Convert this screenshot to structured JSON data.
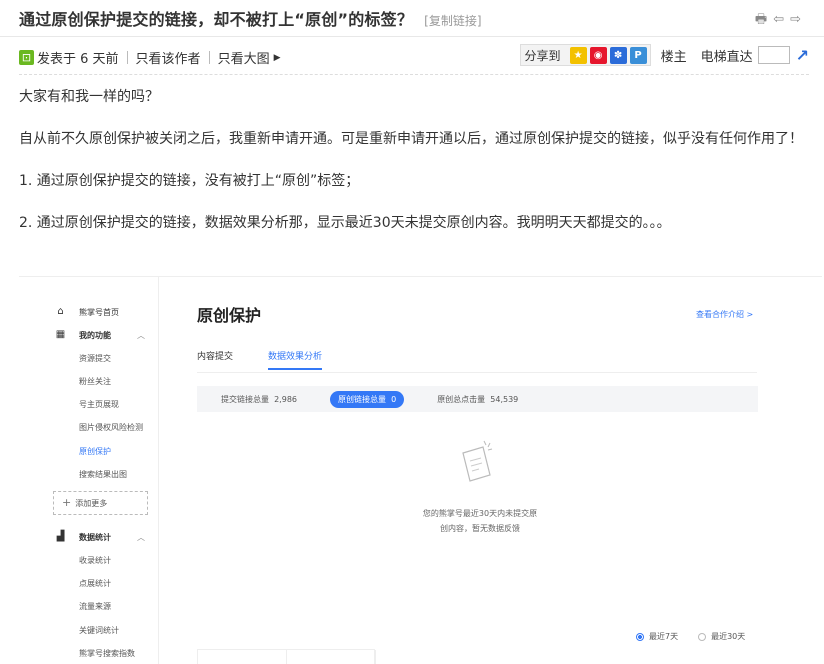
{
  "title": {
    "text": "通过原创保护提交的链接，却不被打上“原创”的标签？",
    "copy_link": "[复制链接]"
  },
  "meta": {
    "posted": "发表于 6 天前",
    "only_author": "只看该作者",
    "only_big_image": "只看大图",
    "share_label": "分享到",
    "louzhu": "楼主",
    "elevator": "电梯直达"
  },
  "post": {
    "lines": [
      "大家有和我一样的吗？",
      "自从前不久原创保护被关闭之后，我重新申请开通。可是重新申请开通以后，通过原创保护提交的链接，似乎没有任何作用了！",
      "1. 通过原创保护提交的链接，没有被打上“原创”标签；",
      "2. 通过原创保护提交的链接，数据效果分析那，显示最近30天未提交原创内容。我明明天天都提交的。。。"
    ]
  },
  "screenshot": {
    "sidebar": {
      "home": "熊掌号首页",
      "my_functions": "我的功能",
      "items": [
        "资源提交",
        "粉丝关注",
        "号主页展现",
        "图片侵权风险检测",
        "原创保护",
        "搜索结果出图"
      ],
      "add_more": "添加更多",
      "data_stats": "数据统计",
      "data_items": [
        "收录统计",
        "点展统计",
        "流量来源",
        "关键词统计",
        "熊掌号搜索指数"
      ]
    },
    "main": {
      "title": "原创保护",
      "coop_link": "查看合作介绍 >",
      "tabs": [
        "内容提交",
        "数据效果分析"
      ],
      "stats": [
        {
          "label": "提交链接总量",
          "value": "2,986"
        },
        {
          "label": "原创链接总量",
          "value": "0"
        },
        {
          "label": "原创总点击量",
          "value": "54,539"
        }
      ],
      "empty_line1": "您的熊掌号最近30天内未提交原",
      "empty_line2": "创内容，暂无数据反馈",
      "range_options": [
        "最近7天",
        "最近30天"
      ]
    }
  }
}
